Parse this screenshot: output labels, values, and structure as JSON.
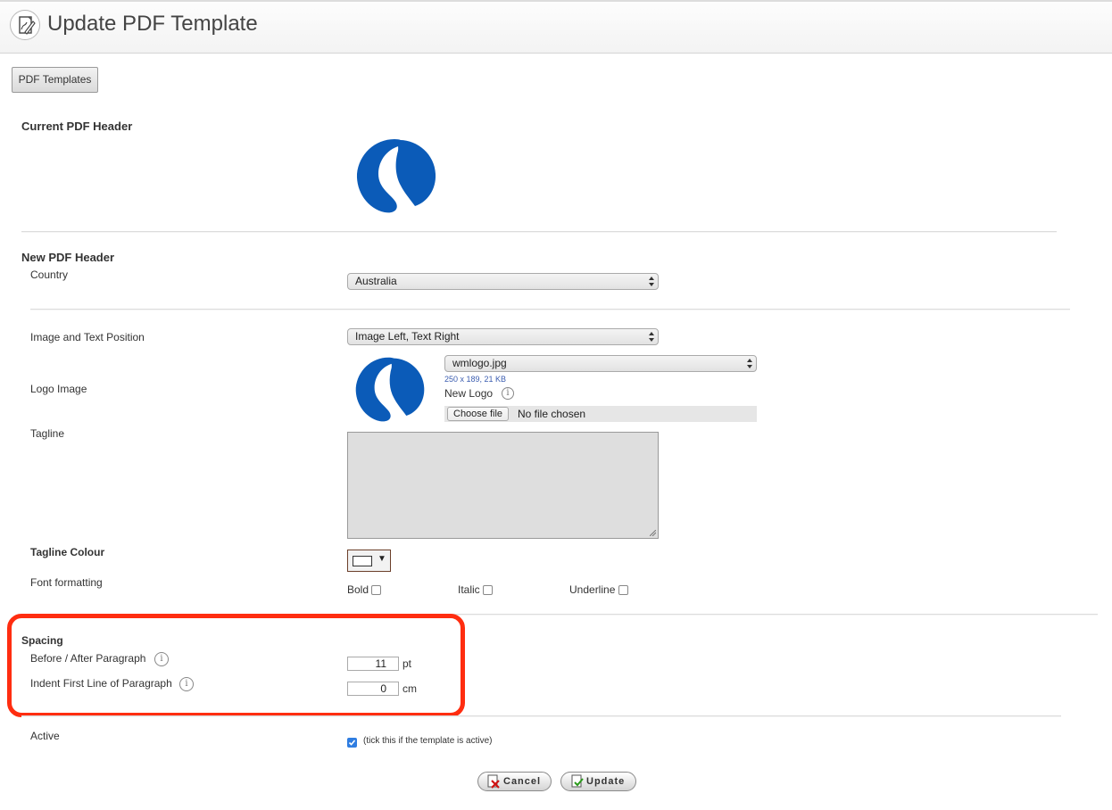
{
  "header": {
    "title": "Update PDF Template",
    "icon": "pdf-edit-icon"
  },
  "nav": {
    "templates_button": "PDF Templates"
  },
  "current_header": {
    "title": "Current PDF Header"
  },
  "new_header": {
    "title": "New PDF Header",
    "country_label": "Country",
    "country_value": "Australia",
    "position_label": "Image and Text Position",
    "position_value": "Image Left, Text Right",
    "logo_label": "Logo Image",
    "logo_file": "wmlogo.jpg",
    "logo_meta": "250 x 189, 21 KB",
    "new_logo_label": "New Logo",
    "choose_file_label": "Choose file",
    "no_file_text": "No file chosen",
    "tagline_label": "Tagline",
    "tagline_value": "",
    "tagline_colour_label": "Tagline Colour",
    "tagline_colour": "#ffffff",
    "font_formatting_label": "Font formatting",
    "bold_label": "Bold",
    "italic_label": "Italic",
    "underline_label": "Underline"
  },
  "spacing": {
    "title": "Spacing",
    "paragraph_label": "Before / After Paragraph",
    "paragraph_value": "11",
    "paragraph_unit": "pt",
    "indent_label": "Indent First Line of Paragraph",
    "indent_value": "0",
    "indent_unit": "cm"
  },
  "active": {
    "label": "Active",
    "note": "(tick this if the template is active)",
    "checked": true
  },
  "actions": {
    "cancel": "Cancel",
    "update": "Update"
  },
  "colors": {
    "brand_blue": "#0b5bb8",
    "highlight": "#ff2d10",
    "checkbox_on": "#2f7de1"
  }
}
